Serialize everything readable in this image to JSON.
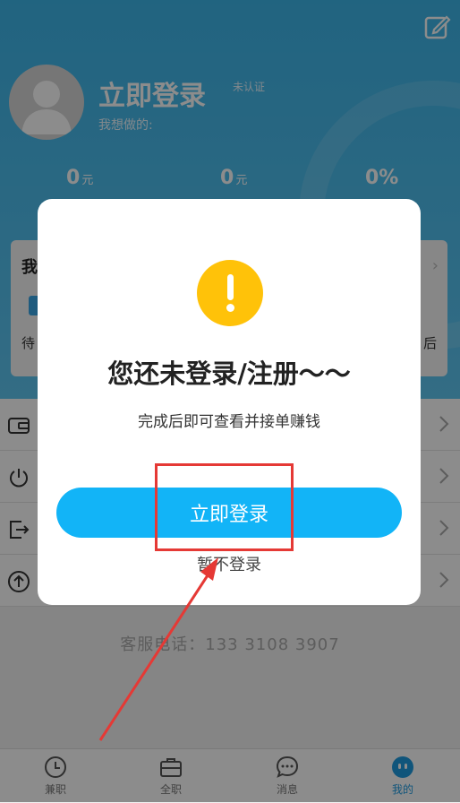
{
  "profile": {
    "login_title": "立即登录",
    "verify_status": "未认证",
    "want_do": "我想做的:",
    "stats": [
      {
        "value": "0",
        "unit": "元"
      },
      {
        "value": "0",
        "unit": "元"
      },
      {
        "value": "0%",
        "unit": ""
      }
    ]
  },
  "panel": {
    "title": "我",
    "left_label": "待",
    "right_label": "后"
  },
  "menu": {
    "items": [
      {
        "icon": "wallet-icon"
      },
      {
        "icon": "power-icon"
      },
      {
        "icon": "exit-icon"
      },
      {
        "icon": "upload-icon"
      }
    ]
  },
  "service": {
    "text": "客服电话：133 3108 3907"
  },
  "tabbar": {
    "tabs": [
      {
        "label": "兼职",
        "icon": "clock-icon"
      },
      {
        "label": "全职",
        "icon": "briefcase-icon"
      },
      {
        "label": "消息",
        "icon": "chat-icon"
      },
      {
        "label": "我的",
        "icon": "face-icon",
        "active": true
      }
    ]
  },
  "dialog": {
    "title": "您还未登录/注册～～",
    "subtitle": "完成后即可查看并接单赚钱",
    "login_button": "立即登录",
    "skip_button": "暂不登录"
  },
  "colors": {
    "header": "#3db6ea",
    "accent": "#12b4f7",
    "warning": "#ffc209",
    "annotation": "#e53935"
  }
}
